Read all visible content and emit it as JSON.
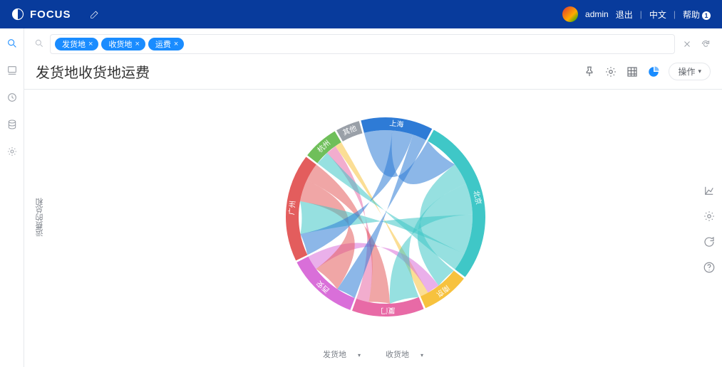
{
  "header": {
    "brand": "FOCUS",
    "user": "admin",
    "logout": "退出",
    "lang": "中文",
    "help": "帮助",
    "help_badge": "1"
  },
  "search": {
    "chips": [
      "发货地",
      "收货地",
      "运费"
    ]
  },
  "title": "发货地收货地运费",
  "y_axis_label": "运费的总和",
  "actions": {
    "operate": "操作"
  },
  "legend": {
    "a": "发货地",
    "b": "收货地"
  },
  "chart_data": {
    "type": "chord",
    "title": "发货地收货地运费",
    "nodes": [
      {
        "name": "上海",
        "color": "#2e7bd6",
        "weight": 12
      },
      {
        "name": "北京",
        "color": "#3fc7c7",
        "weight": 28
      },
      {
        "name": "南京",
        "color": "#f7c23e",
        "weight": 8
      },
      {
        "name": "厦门",
        "color": "#e86aa6",
        "weight": 12
      },
      {
        "name": "西安",
        "color": "#d96fd9",
        "weight": 12
      },
      {
        "name": "广州",
        "color": "#e35d5d",
        "weight": 18
      },
      {
        "name": "杭州",
        "color": "#6fbf5a",
        "weight": 6
      },
      {
        "name": "其他",
        "color": "#9aa0a8",
        "weight": 4
      }
    ],
    "links": [
      {
        "source": "上海",
        "target": "北京",
        "value": 8
      },
      {
        "source": "上海",
        "target": "广州",
        "value": 6
      },
      {
        "source": "上海",
        "target": "西安",
        "value": 4
      },
      {
        "source": "北京",
        "target": "南京",
        "value": 5
      },
      {
        "source": "北京",
        "target": "厦门",
        "value": 7
      },
      {
        "source": "北京",
        "target": "广州",
        "value": 9
      },
      {
        "source": "北京",
        "target": "杭州",
        "value": 4
      },
      {
        "source": "广州",
        "target": "西安",
        "value": 6
      },
      {
        "source": "广州",
        "target": "厦门",
        "value": 5
      },
      {
        "source": "西安",
        "target": "南京",
        "value": 3
      },
      {
        "source": "厦门",
        "target": "杭州",
        "value": 3
      },
      {
        "source": "南京",
        "target": "杭州",
        "value": 2
      }
    ],
    "note": "values are estimated proportions read from arc lengths and ribbon widths"
  }
}
